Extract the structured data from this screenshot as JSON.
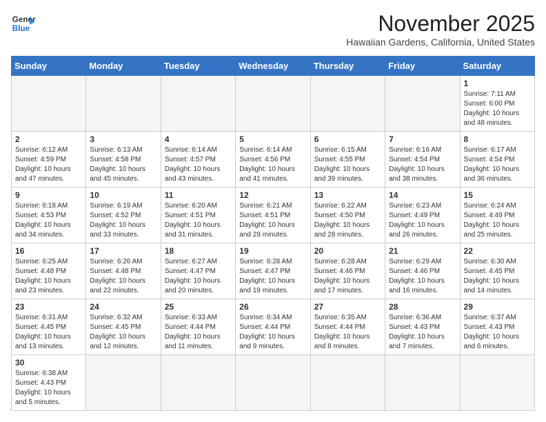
{
  "header": {
    "logo_line1": "General",
    "logo_line2": "Blue",
    "month": "November 2025",
    "location": "Hawaiian Gardens, California, United States"
  },
  "weekdays": [
    "Sunday",
    "Monday",
    "Tuesday",
    "Wednesday",
    "Thursday",
    "Friday",
    "Saturday"
  ],
  "weeks": [
    [
      {
        "day": "",
        "info": ""
      },
      {
        "day": "",
        "info": ""
      },
      {
        "day": "",
        "info": ""
      },
      {
        "day": "",
        "info": ""
      },
      {
        "day": "",
        "info": ""
      },
      {
        "day": "",
        "info": ""
      },
      {
        "day": "1",
        "info": "Sunrise: 7:11 AM\nSunset: 6:00 PM\nDaylight: 10 hours\nand 48 minutes."
      }
    ],
    [
      {
        "day": "2",
        "info": "Sunrise: 6:12 AM\nSunset: 4:59 PM\nDaylight: 10 hours\nand 47 minutes."
      },
      {
        "day": "3",
        "info": "Sunrise: 6:13 AM\nSunset: 4:58 PM\nDaylight: 10 hours\nand 45 minutes."
      },
      {
        "day": "4",
        "info": "Sunrise: 6:14 AM\nSunset: 4:57 PM\nDaylight: 10 hours\nand 43 minutes."
      },
      {
        "day": "5",
        "info": "Sunrise: 6:14 AM\nSunset: 4:56 PM\nDaylight: 10 hours\nand 41 minutes."
      },
      {
        "day": "6",
        "info": "Sunrise: 6:15 AM\nSunset: 4:55 PM\nDaylight: 10 hours\nand 39 minutes."
      },
      {
        "day": "7",
        "info": "Sunrise: 6:16 AM\nSunset: 4:54 PM\nDaylight: 10 hours\nand 38 minutes."
      },
      {
        "day": "8",
        "info": "Sunrise: 6:17 AM\nSunset: 4:54 PM\nDaylight: 10 hours\nand 36 minutes."
      }
    ],
    [
      {
        "day": "9",
        "info": "Sunrise: 6:18 AM\nSunset: 4:53 PM\nDaylight: 10 hours\nand 34 minutes."
      },
      {
        "day": "10",
        "info": "Sunrise: 6:19 AM\nSunset: 4:52 PM\nDaylight: 10 hours\nand 33 minutes."
      },
      {
        "day": "11",
        "info": "Sunrise: 6:20 AM\nSunset: 4:51 PM\nDaylight: 10 hours\nand 31 minutes."
      },
      {
        "day": "12",
        "info": "Sunrise: 6:21 AM\nSunset: 4:51 PM\nDaylight: 10 hours\nand 29 minutes."
      },
      {
        "day": "13",
        "info": "Sunrise: 6:22 AM\nSunset: 4:50 PM\nDaylight: 10 hours\nand 28 minutes."
      },
      {
        "day": "14",
        "info": "Sunrise: 6:23 AM\nSunset: 4:49 PM\nDaylight: 10 hours\nand 26 minutes."
      },
      {
        "day": "15",
        "info": "Sunrise: 6:24 AM\nSunset: 4:49 PM\nDaylight: 10 hours\nand 25 minutes."
      }
    ],
    [
      {
        "day": "16",
        "info": "Sunrise: 6:25 AM\nSunset: 4:48 PM\nDaylight: 10 hours\nand 23 minutes."
      },
      {
        "day": "17",
        "info": "Sunrise: 6:26 AM\nSunset: 4:48 PM\nDaylight: 10 hours\nand 22 minutes."
      },
      {
        "day": "18",
        "info": "Sunrise: 6:27 AM\nSunset: 4:47 PM\nDaylight: 10 hours\nand 20 minutes."
      },
      {
        "day": "19",
        "info": "Sunrise: 6:28 AM\nSunset: 4:47 PM\nDaylight: 10 hours\nand 19 minutes."
      },
      {
        "day": "20",
        "info": "Sunrise: 6:28 AM\nSunset: 4:46 PM\nDaylight: 10 hours\nand 17 minutes."
      },
      {
        "day": "21",
        "info": "Sunrise: 6:29 AM\nSunset: 4:46 PM\nDaylight: 10 hours\nand 16 minutes."
      },
      {
        "day": "22",
        "info": "Sunrise: 6:30 AM\nSunset: 4:45 PM\nDaylight: 10 hours\nand 14 minutes."
      }
    ],
    [
      {
        "day": "23",
        "info": "Sunrise: 6:31 AM\nSunset: 4:45 PM\nDaylight: 10 hours\nand 13 minutes."
      },
      {
        "day": "24",
        "info": "Sunrise: 6:32 AM\nSunset: 4:45 PM\nDaylight: 10 hours\nand 12 minutes."
      },
      {
        "day": "25",
        "info": "Sunrise: 6:33 AM\nSunset: 4:44 PM\nDaylight: 10 hours\nand 11 minutes."
      },
      {
        "day": "26",
        "info": "Sunrise: 6:34 AM\nSunset: 4:44 PM\nDaylight: 10 hours\nand 9 minutes."
      },
      {
        "day": "27",
        "info": "Sunrise: 6:35 AM\nSunset: 4:44 PM\nDaylight: 10 hours\nand 8 minutes."
      },
      {
        "day": "28",
        "info": "Sunrise: 6:36 AM\nSunset: 4:43 PM\nDaylight: 10 hours\nand 7 minutes."
      },
      {
        "day": "29",
        "info": "Sunrise: 6:37 AM\nSunset: 4:43 PM\nDaylight: 10 hours\nand 6 minutes."
      }
    ],
    [
      {
        "day": "30",
        "info": "Sunrise: 6:38 AM\nSunset: 4:43 PM\nDaylight: 10 hours\nand 5 minutes."
      },
      {
        "day": "",
        "info": ""
      },
      {
        "day": "",
        "info": ""
      },
      {
        "day": "",
        "info": ""
      },
      {
        "day": "",
        "info": ""
      },
      {
        "day": "",
        "info": ""
      },
      {
        "day": "",
        "info": ""
      }
    ]
  ]
}
